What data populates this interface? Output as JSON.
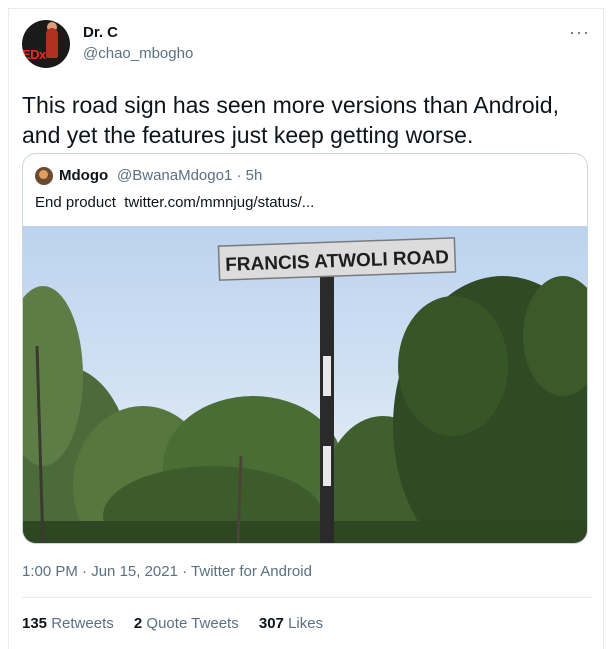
{
  "tweet": {
    "author_name": "Dr. C",
    "author_handle": "@chao_mbogho",
    "avatar_text": "EDx",
    "more_icon": "···",
    "text": "This road sign has seen more versions than Android, and yet the features just keep getting worse."
  },
  "quoted_tweet": {
    "author_name": "Mdogo",
    "author_handle": "@BwanaMdogo1 · 5h",
    "text": "End product",
    "link": "twitter.com/mmnjug/status/...",
    "sign_text": "FRANCIS ATWOLI ROAD"
  },
  "meta": {
    "time": "1:00 PM",
    "separator1": " · ",
    "date": "Jun 15, 2021",
    "separator2": " · ",
    "client": "Twitter for Android"
  },
  "stats": {
    "retweets_count": "135",
    "retweets_label": "Retweets",
    "quote_count": "2",
    "quote_label": "Quote Tweets",
    "likes_count": "307",
    "likes_label": "Likes"
  },
  "colors": {
    "secondary_text": "#5b7083",
    "border": "#ccd6dd",
    "sign_background": "#dcdcdc",
    "pole": "#2a2a2a"
  }
}
